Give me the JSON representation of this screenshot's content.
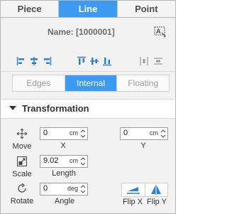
{
  "top_tabs": [
    "Piece",
    "Line",
    "Point"
  ],
  "name_label": "Name: [1000001]",
  "sub_tabs": [
    "Edges",
    "Internal",
    "Floating"
  ],
  "section": {
    "title": "Transformation"
  },
  "move": {
    "label": "Move",
    "x": {
      "value": "0",
      "unit": "cm",
      "label": "X"
    },
    "y": {
      "value": "0",
      "unit": "cm",
      "label": "Y"
    }
  },
  "scale": {
    "label": "Scale",
    "length": {
      "value": "9.02",
      "unit": "cm",
      "label": "Length"
    }
  },
  "rotate": {
    "label": "Rotate",
    "angle": {
      "value": "0",
      "unit": "deg",
      "label": "Angle"
    }
  },
  "flip": {
    "x_label": "Flip X",
    "y_label": "Flip Y"
  },
  "colors": {
    "accent": "#3c9af0",
    "icon_blue": "#2f7fd6"
  }
}
